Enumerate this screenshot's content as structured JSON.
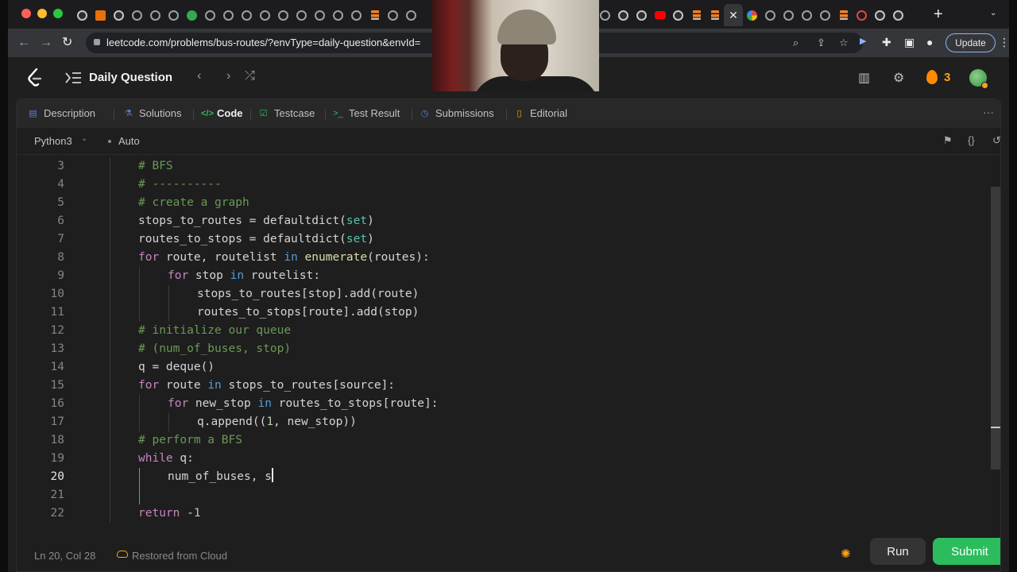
{
  "browser": {
    "url": "leetcode.com/problems/bus-routes/?envType=daily-question&envId=",
    "update_label": "Update",
    "new_tab_label": "+",
    "tab_search_label": "⌄"
  },
  "leetcode_nav": {
    "title": "Daily Question",
    "streak_count": "3"
  },
  "panel_tabs": [
    {
      "label": "Description",
      "icon": "description-icon"
    },
    {
      "label": "Solutions",
      "icon": "flask-icon"
    },
    {
      "label": "Code",
      "icon": "code-icon",
      "active": true
    },
    {
      "label": "Testcase",
      "icon": "checkbox-icon"
    },
    {
      "label": "Test Result",
      "icon": "terminal-icon"
    },
    {
      "label": "Submissions",
      "icon": "history-icon"
    },
    {
      "label": "Editorial",
      "icon": "book-icon"
    }
  ],
  "editor_toolbar": {
    "language": "Python3",
    "mode": "Auto"
  },
  "code": {
    "current_line": 20,
    "lines": [
      {
        "num": "3",
        "indent": 1,
        "tokens": [
          {
            "t": "# BFS",
            "c": "cm"
          }
        ]
      },
      {
        "num": "4",
        "indent": 1,
        "tokens": [
          {
            "t": "# ----------",
            "c": "cm"
          }
        ]
      },
      {
        "num": "5",
        "indent": 1,
        "tokens": [
          {
            "t": "# create a graph",
            "c": "cm"
          }
        ]
      },
      {
        "num": "6",
        "indent": 1,
        "tokens": [
          {
            "t": "stops_to_routes = ",
            "c": ""
          },
          {
            "t": "defaultdict",
            "c": ""
          },
          {
            "t": "(",
            "c": ""
          },
          {
            "t": "set",
            "c": "ty"
          },
          {
            "t": ")",
            "c": ""
          }
        ]
      },
      {
        "num": "7",
        "indent": 1,
        "tokens": [
          {
            "t": "routes_to_stops = ",
            "c": ""
          },
          {
            "t": "defaultdict",
            "c": ""
          },
          {
            "t": "(",
            "c": ""
          },
          {
            "t": "set",
            "c": "ty"
          },
          {
            "t": ")",
            "c": ""
          }
        ]
      },
      {
        "num": "8",
        "indent": 1,
        "tokens": [
          {
            "t": "for",
            "c": "kw"
          },
          {
            "t": " route, routelist ",
            "c": ""
          },
          {
            "t": "in",
            "c": "bl"
          },
          {
            "t": " ",
            "c": ""
          },
          {
            "t": "enumerate",
            "c": "fn"
          },
          {
            "t": "(routes):",
            "c": ""
          }
        ]
      },
      {
        "num": "9",
        "indent": 2,
        "tokens": [
          {
            "t": "for",
            "c": "kw"
          },
          {
            "t": " stop ",
            "c": ""
          },
          {
            "t": "in",
            "c": "bl"
          },
          {
            "t": " routelist:",
            "c": ""
          }
        ]
      },
      {
        "num": "10",
        "indent": 3,
        "tokens": [
          {
            "t": "stops_to_routes[stop].add(route)",
            "c": ""
          }
        ]
      },
      {
        "num": "11",
        "indent": 3,
        "tokens": [
          {
            "t": "routes_to_stops[route].add(stop)",
            "c": ""
          }
        ]
      },
      {
        "num": "12",
        "indent": 1,
        "tokens": [
          {
            "t": "# initialize our queue",
            "c": "cm"
          }
        ]
      },
      {
        "num": "13",
        "indent": 1,
        "tokens": [
          {
            "t": "# (num_of_buses, stop)",
            "c": "cm"
          }
        ]
      },
      {
        "num": "14",
        "indent": 1,
        "tokens": [
          {
            "t": "q = deque()",
            "c": ""
          }
        ]
      },
      {
        "num": "15",
        "indent": 1,
        "tokens": [
          {
            "t": "for",
            "c": "kw"
          },
          {
            "t": " route ",
            "c": ""
          },
          {
            "t": "in",
            "c": "bl"
          },
          {
            "t": " stops_to_routes[source]:",
            "c": ""
          }
        ]
      },
      {
        "num": "16",
        "indent": 2,
        "tokens": [
          {
            "t": "for",
            "c": "kw"
          },
          {
            "t": " new_stop ",
            "c": ""
          },
          {
            "t": "in",
            "c": "bl"
          },
          {
            "t": " routes_to_stops[route]:",
            "c": ""
          }
        ]
      },
      {
        "num": "17",
        "indent": 3,
        "tokens": [
          {
            "t": "q.append((",
            "c": ""
          },
          {
            "t": "1",
            "c": "num"
          },
          {
            "t": ", new_stop))",
            "c": ""
          }
        ]
      },
      {
        "num": "18",
        "indent": 1,
        "tokens": [
          {
            "t": "# perform a BFS",
            "c": "cm"
          }
        ]
      },
      {
        "num": "19",
        "indent": 1,
        "tokens": [
          {
            "t": "while",
            "c": "kw"
          },
          {
            "t": " q:",
            "c": ""
          }
        ]
      },
      {
        "num": "20",
        "indent": 2,
        "tokens": [
          {
            "t": "num_of_buses, s",
            "c": ""
          }
        ],
        "cursor": true
      },
      {
        "num": "21",
        "indent": 0,
        "tokens": []
      },
      {
        "num": "22",
        "indent": 1,
        "tokens": [
          {
            "t": "return",
            "c": "kw"
          },
          {
            "t": " -",
            "c": ""
          },
          {
            "t": "1",
            "c": "num"
          }
        ]
      }
    ]
  },
  "status": {
    "position": "Ln 20, Col 28",
    "restored": "Restored from Cloud",
    "run_label": "Run",
    "submit_label": "Submit"
  },
  "colors": {
    "accent": "#ffa116",
    "submit": "#2cbb5d",
    "comment": "#6a9955",
    "keyword": "#c586c0"
  }
}
